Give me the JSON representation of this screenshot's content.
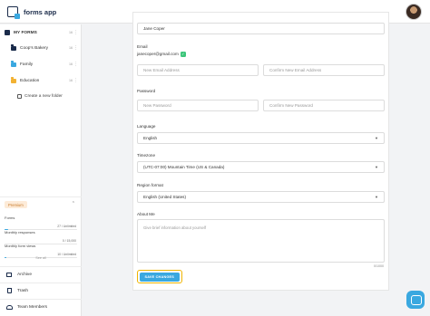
{
  "app": {
    "logo_text": "forms app"
  },
  "sidebar": {
    "my_forms": {
      "label": "MY FORMS",
      "count": "16"
    },
    "folders": [
      {
        "label": "Coop's Bakery",
        "count": "16",
        "color": "#1a2b4a"
      },
      {
        "label": "Family",
        "count": "16",
        "color": "#3aa8e0"
      },
      {
        "label": "Education",
        "count": "16",
        "color": "#f2b233"
      }
    ],
    "create_folder": "Create a new folder",
    "premium": {
      "badge": "Premium",
      "usage": [
        {
          "label": "Forms",
          "value": "27 / Unlimited",
          "fill": 0.05
        },
        {
          "label": "Monthly responses",
          "value": "0 / 15,000",
          "fill": 0.0
        },
        {
          "label": "Monthly form views",
          "value": "10 / Unlimited",
          "fill": 0.02
        }
      ],
      "see_all": "See all"
    },
    "bottom": [
      {
        "label": "Archive"
      },
      {
        "label": "Trash"
      },
      {
        "label": "Team Members"
      }
    ]
  },
  "form": {
    "name_value": "Jane Coper",
    "email_label": "Email",
    "email_value": "janecoper@gmail.com",
    "new_email_placeholder": "New Email Address",
    "confirm_email_placeholder": "Confirm New Email Address",
    "password_label": "Password",
    "new_password_placeholder": "New Password",
    "confirm_password_placeholder": "Confirm New Password",
    "language_label": "Language",
    "language_value": "English",
    "timezone_label": "Timezone",
    "timezone_value": "(UTC-07:00) Mountain Time (US & Canada)",
    "region_label": "Region format",
    "region_value": "English (United States)",
    "about_label": "About Me",
    "about_placeholder": "Give brief information about yourself",
    "about_counter": "0/1000",
    "save_label": "SAVE CHANGES"
  },
  "colors": {
    "accent": "#3aa8e0",
    "focus_ring": "#f0b400",
    "verified": "#3cc57a"
  }
}
